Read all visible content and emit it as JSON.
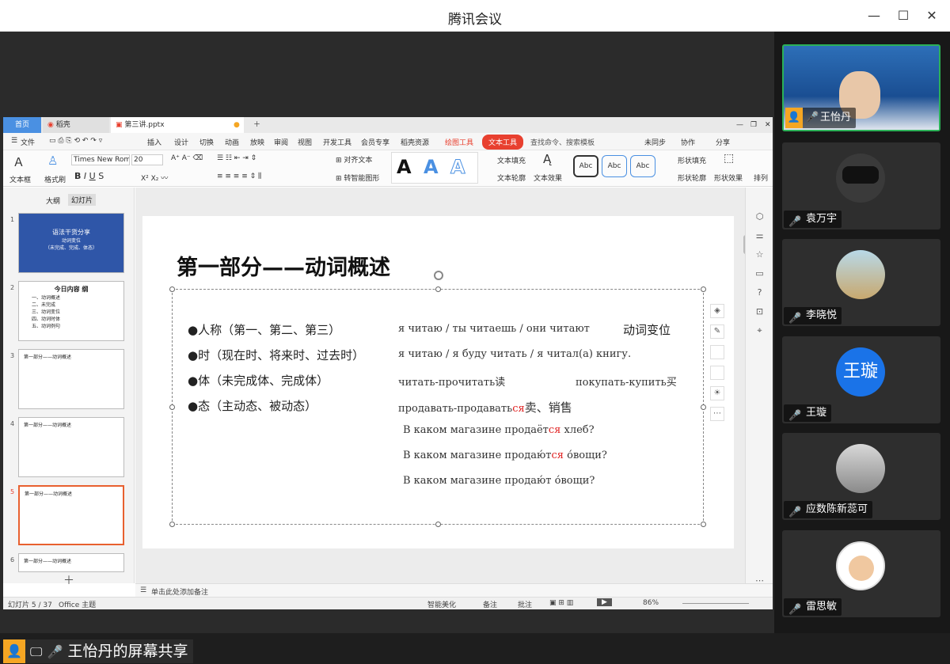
{
  "window": {
    "title": "腾讯会议"
  },
  "wps": {
    "tabs": [
      {
        "label": "首页"
      },
      {
        "label": "稻壳"
      },
      {
        "label": "第三讲.pptx"
      }
    ],
    "menu": [
      "文件",
      "插入",
      "设计",
      "切换",
      "动画",
      "放映",
      "审阅",
      "视图",
      "开发工具",
      "会员专享",
      "稻壳资源",
      "绘图工具",
      "文本工具",
      "查找命令、搜索模板"
    ],
    "menu_right": [
      "未同步",
      "协作",
      "分享"
    ],
    "ribbon": {
      "textbox_label": "文本框",
      "format_brush": "格式刷",
      "font_name": "Times New Roman",
      "font_size": "20",
      "align_text": "对齐文本",
      "smart_graphic": "转智能图形",
      "text_fill": "文本填充",
      "text_outline": "文本轮廓",
      "text_effect": "文本效果",
      "style_sample": "Abc",
      "shape_fill": "形状填充",
      "shape_outline": "形状轮廓",
      "shape_effect": "形状效果",
      "arrange": "排列"
    },
    "panel_tabs": [
      "大纲",
      "幻灯片"
    ],
    "thumbnails": [
      {
        "num": "1",
        "title": "语法干货分享",
        "sub": "动词变位",
        "sub2": "（未完成、完成、体态）"
      },
      {
        "num": "2",
        "title": "今日内容  纲",
        "lines": [
          "一、动词概述",
          "二、未完成",
          "三、动词变位",
          "四、动词时体",
          "五、动词例句"
        ]
      },
      {
        "num": "3",
        "title": "第一部分——动词概述"
      },
      {
        "num": "4",
        "title": "第一部分——动词概述"
      },
      {
        "num": "5",
        "title": "第一部分——动词概述"
      },
      {
        "num": "6",
        "title": "第一部分——动词概述"
      }
    ],
    "slide": {
      "title": "第一部分——动词概述",
      "bullets": [
        "●人称（第一、第二、第三）",
        "●时（现在时、将来时、过去时）",
        "●体（未完成体、完成体）",
        "●态（主动态、被动态）"
      ],
      "ru": [
        {
          "text": "я читаю / ты читаешь / они читают",
          "extra": "动词变位"
        },
        {
          "text": "я читаю / я буду читать / я читал(а) книгу."
        },
        {
          "text": "читать-прочитать读",
          "extra": "покупать-купить买"
        },
        {
          "pre": "продавать-продавать",
          "red": "ся",
          "post": "卖、销售"
        },
        {
          "pre": "В каком магазине продаёт",
          "red": "ся",
          "post": " хлеб?"
        },
        {
          "pre": "В каком магазине продаю́т",
          "red": "ся",
          "post": " о́вощи?"
        },
        {
          "pre": "В каком магазине продаю́т  о́вощи?"
        }
      ]
    },
    "notes": "单击此处添加备注",
    "status": {
      "slide_count": "幻灯片 5 / 37",
      "theme": "Office 主题",
      "beautify": "智能美化",
      "notes": "备注",
      "comment": "批注",
      "zoom": "86%"
    }
  },
  "sharer": {
    "label": "王怡丹的屏幕共享"
  },
  "participants": [
    {
      "name": "王怡丹",
      "muted": false,
      "active": true
    },
    {
      "name": "袁万宇",
      "muted": true
    },
    {
      "name": "李晓悦",
      "muted": true
    },
    {
      "name": "王璇",
      "muted": true,
      "initials": "王璇"
    },
    {
      "name": "应数陈新蕊可",
      "muted": true
    },
    {
      "name": "雷思敏",
      "muted": true
    }
  ],
  "colors": {
    "accent": "#2bb157",
    "wps_red": "#e8402f",
    "avatar_blue": "#1a73e8"
  }
}
